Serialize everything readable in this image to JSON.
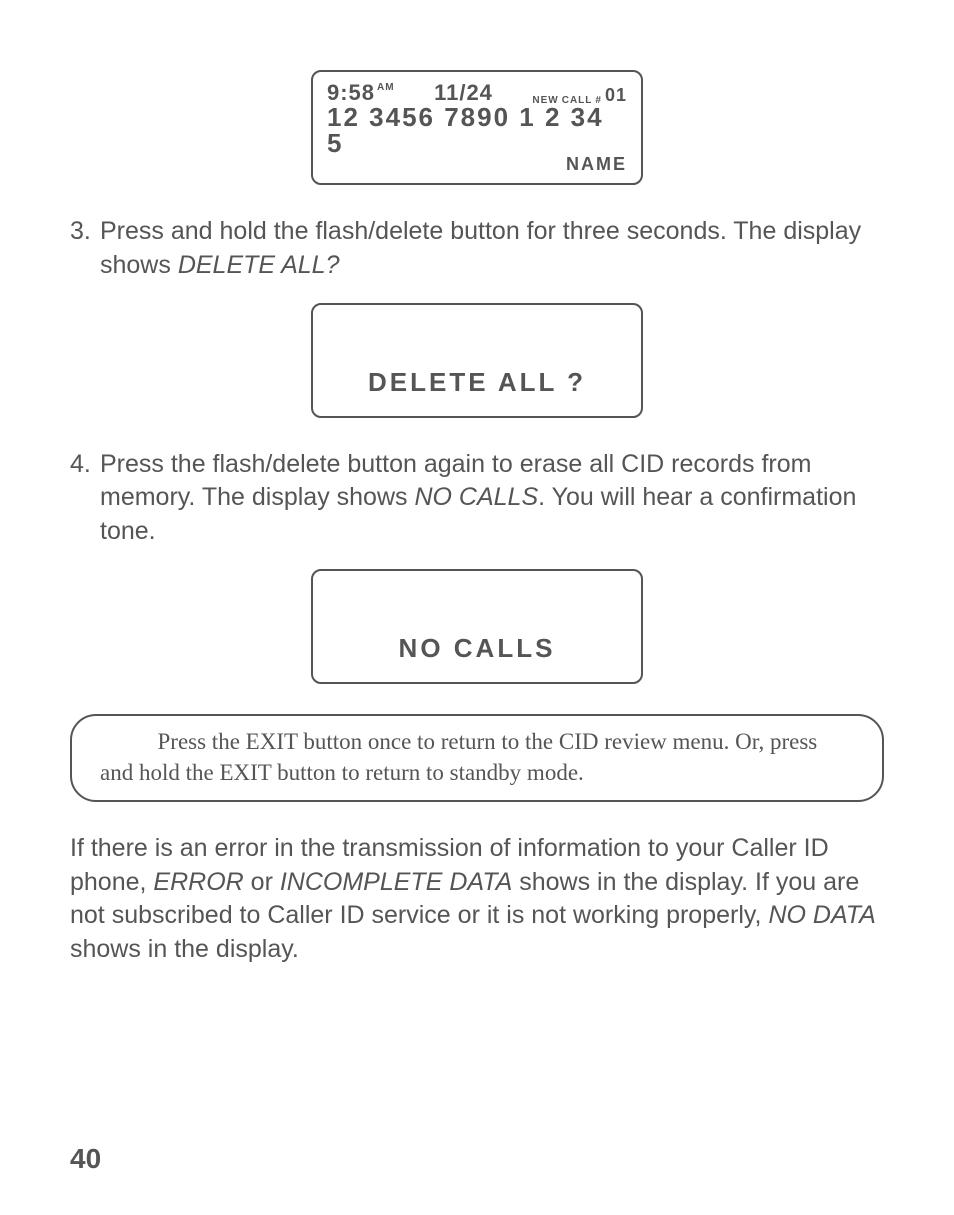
{
  "lcd1": {
    "time": "9:58",
    "ampm": "AM",
    "date": "11/24",
    "new_label": "NEW",
    "call_label": "CALL",
    "hash": "#",
    "call_num": "01",
    "phone": "12 3456 7890 1 2 34 5",
    "name": "NAME"
  },
  "step3": {
    "num": "3.",
    "text_a": "Press and hold the flash/delete button for three seconds. The display shows ",
    "text_b": "DELETE ALL?"
  },
  "lcd2": {
    "text": "DELETE ALL ?"
  },
  "step4": {
    "num": "4.",
    "text_a": "Press the flash/delete button again to erase all CID records from memory. The display shows ",
    "text_b": "NO CALLS",
    "text_c": ". You will hear a confirmation tone."
  },
  "lcd3": {
    "text": "NO CALLS"
  },
  "note": {
    "indent": "          ",
    "text": "Press the EXIT button once to return to the CID review menu. Or, press and hold the EXIT button to return to standby mode."
  },
  "para": {
    "a": "If there is an error in the transmission of information to your Caller ID phone, ",
    "b": "ERROR",
    "c": " or ",
    "d": "INCOMPLETE DATA",
    "e": " shows in the display. If you are not subscribed to Caller ID service or it is not working properly, ",
    "f": "NO DATA",
    "g": " shows in the display."
  },
  "page": "40"
}
